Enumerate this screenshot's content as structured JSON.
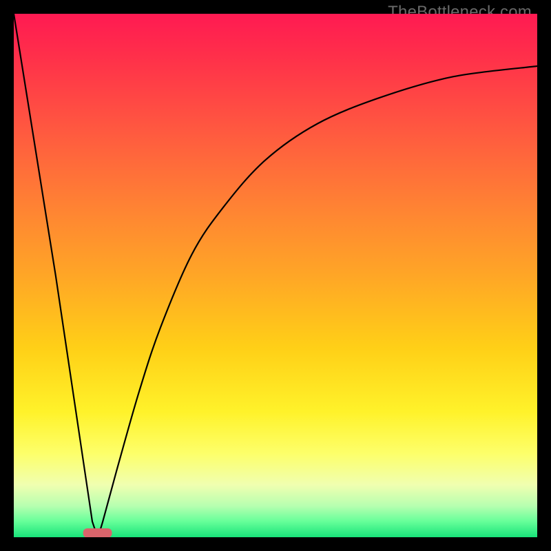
{
  "watermark": "TheBottleneck.com",
  "chart_data": {
    "type": "line",
    "title": "",
    "xlabel": "",
    "ylabel": "",
    "xlim": [
      0,
      100
    ],
    "ylim": [
      0,
      100
    ],
    "legend": false,
    "grid": false,
    "background": {
      "type": "vertical-gradient",
      "stops": [
        {
          "pos": 0.0,
          "color": "#ff1a52"
        },
        {
          "pos": 0.22,
          "color": "#ff5840"
        },
        {
          "pos": 0.5,
          "color": "#ffa626"
        },
        {
          "pos": 0.76,
          "color": "#fff22a"
        },
        {
          "pos": 0.9,
          "color": "#f0ffb0"
        },
        {
          "pos": 1.0,
          "color": "#18e37a"
        }
      ]
    },
    "curve": {
      "description": "V-shaped curve: steep linear drop from (0,100) to a minimum near x≈16 at y≈0, then rises along a saturating curve approaching ~90 at the right edge.",
      "min_x": 16,
      "points": [
        {
          "x": 0,
          "y": 100
        },
        {
          "x": 8,
          "y": 50
        },
        {
          "x": 15,
          "y": 3
        },
        {
          "x": 16,
          "y": 0
        },
        {
          "x": 17,
          "y": 3
        },
        {
          "x": 20,
          "y": 14
        },
        {
          "x": 24,
          "y": 28
        },
        {
          "x": 28,
          "y": 40
        },
        {
          "x": 34,
          "y": 54
        },
        {
          "x": 40,
          "y": 63
        },
        {
          "x": 48,
          "y": 72
        },
        {
          "x": 58,
          "y": 79
        },
        {
          "x": 70,
          "y": 84
        },
        {
          "x": 84,
          "y": 88
        },
        {
          "x": 100,
          "y": 90
        }
      ]
    },
    "marker": {
      "shape": "rounded-rect",
      "x": 16,
      "y": 0.8,
      "width": 5.5,
      "height": 1.8,
      "color": "#d9646b"
    }
  }
}
